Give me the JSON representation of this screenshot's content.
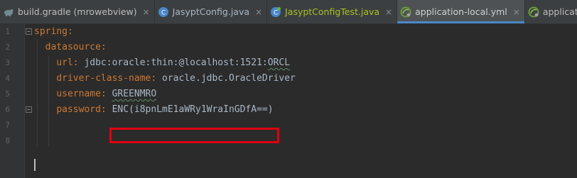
{
  "tabs": [
    {
      "label": "build.gradle (mrowebview)",
      "kind": "gradle",
      "icon": "gradle-icon",
      "active": false
    },
    {
      "label": "JasyptConfig.java",
      "kind": "java",
      "icon": "java-class-icon",
      "active": false
    },
    {
      "label": "JasyptConfigTest.java",
      "kind": "test",
      "icon": "java-test-class-icon",
      "active": false
    },
    {
      "label": "application-local.yml",
      "kind": "yml",
      "icon": "spring-yml-icon",
      "active": true
    },
    {
      "label": "application-test.yml",
      "kind": "yml",
      "icon": "spring-yml-icon",
      "active": false
    }
  ],
  "editor": {
    "line_numbers": [
      "1",
      "2",
      "3",
      "4",
      "5",
      "6",
      "7",
      "8"
    ],
    "lines": [
      {
        "indent": "",
        "key": "spring:",
        "value": ""
      },
      {
        "indent": "  ",
        "key": "datasource:",
        "value": ""
      },
      {
        "indent": "    ",
        "key": "url:",
        "value": " jdbc:oracle:thin:@localhost:1521:",
        "squiggle": "ORCL"
      },
      {
        "indent": "    ",
        "key": "driver-class-name:",
        "value": " oracle.jdbc.OracleDriver"
      },
      {
        "indent": "    ",
        "key": "username:",
        "value": " ",
        "squiggle": "GREENMRO"
      },
      {
        "indent": "    ",
        "key": "password:",
        "value": " ENC(i8pnLmE1aWRy1WraInGDfA==)"
      },
      {
        "indent": "",
        "key": "",
        "value": ""
      },
      {
        "indent": "",
        "key": "",
        "value": ""
      }
    ],
    "colors": {
      "key": "#cc7832",
      "value": "#a9b7c6",
      "highlight_box": "#e00012",
      "background": "#2b2b2b"
    }
  }
}
